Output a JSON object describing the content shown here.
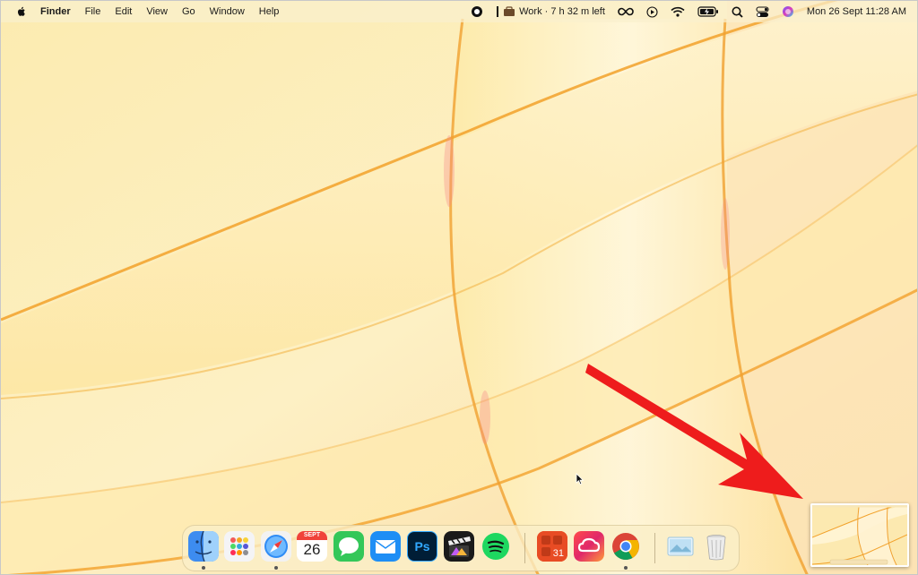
{
  "menubar": {
    "app_name": "Finder",
    "items": [
      "File",
      "Edit",
      "View",
      "Go",
      "Window",
      "Help"
    ],
    "focus_status": "Work · 7 h 32 m left",
    "clock": "Mon 26 Sept  11:28 AM"
  },
  "dock": {
    "calendar_month": "SEPT",
    "calendar_day": "26",
    "photoshop_label": "Ps",
    "fantastical_day": "31"
  },
  "colors": {
    "accent_arrow": "#ee1c1c",
    "wallpaper_base": "#fbe9a8"
  }
}
